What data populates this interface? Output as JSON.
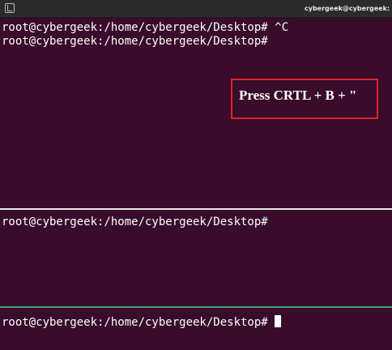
{
  "window": {
    "title": "cybergeek@cybergeek: ~/Deskto",
    "icon": "terminal-icon"
  },
  "panes": [
    {
      "lines": [
        "root@cybergeek:/home/cybergeek/Desktop# ^C",
        "root@cybergeek:/home/cybergeek/Desktop#"
      ]
    },
    {
      "lines": [
        "root@cybergeek:/home/cybergeek/Desktop#"
      ]
    },
    {
      "prompt": "root@cybergeek:/home/cybergeek/Desktop# ",
      "active": true
    }
  ],
  "annotation": {
    "text": "Press CRTL + B + \""
  },
  "colors": {
    "background": "#380c2a",
    "titlebar": "#2b2b2b",
    "divider_inactive": "#e8e8e8",
    "divider_active": "#3aa381",
    "annotation_border": "#e2222b",
    "text": "#ffffff"
  }
}
